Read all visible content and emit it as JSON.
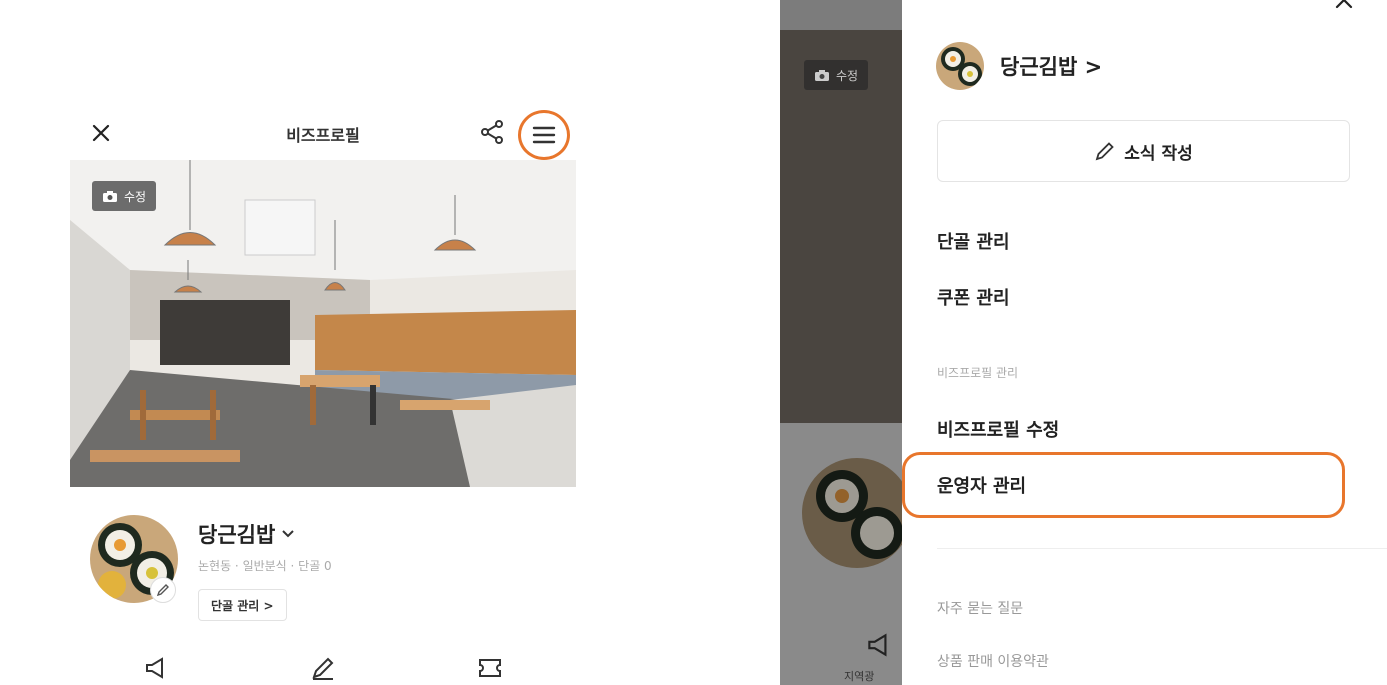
{
  "left_screen": {
    "title": "비즈프로필",
    "photo_edit_label": "수정",
    "shop_name": "당근김밥",
    "shop_meta": "논현동 · 일반분식 · 단골 0",
    "regulars_button": "단골 관리 >"
  },
  "right_screen": {
    "dim_photo_edit_label": "수정",
    "dim_bottom_label": "지역광",
    "shop_name": "당근김밥 >",
    "write_button": "소식 작성",
    "menu": {
      "regulars": "단골 관리",
      "coupons": "쿠폰 관리",
      "section_label": "비즈프로필 관리",
      "edit_profile": "비즈프로필 수정",
      "operator": "운영자 관리"
    },
    "footer": {
      "faq": "자주 묻는 질문",
      "terms": "상품 판매 이용약관"
    }
  },
  "colors": {
    "highlight": "#e8762c",
    "dim_overlay": "#8a8a8a"
  },
  "icons": [
    "close-icon",
    "share-icon",
    "hamburger-menu-icon",
    "camera-icon",
    "pencil-icon",
    "chevron-down-icon",
    "megaphone-icon",
    "coupon-icon"
  ]
}
